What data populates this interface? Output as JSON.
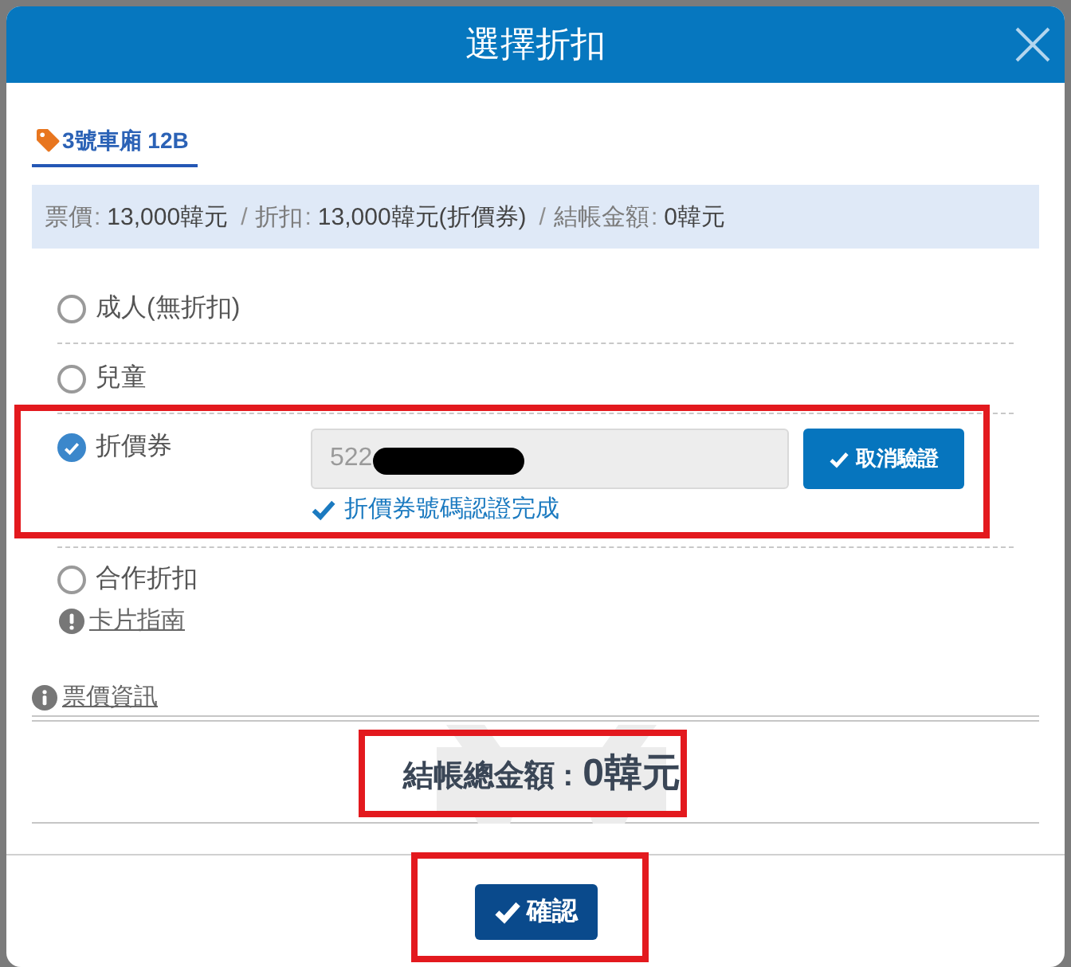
{
  "dialog": {
    "title": "選擇折扣"
  },
  "tabs": [
    {
      "label": "3號車廂 12B",
      "selected": true
    }
  ],
  "summary": [
    {
      "label": "票價",
      "colon": ":",
      "value": "13,000韓元"
    },
    {
      "divider": "/",
      "label": "折扣",
      "colon": ":",
      "value": "13,000韓元(折價券)"
    },
    {
      "divider": "/",
      "label": "結帳金額",
      "colon": ":",
      "value": "0韓元"
    }
  ],
  "options": [
    {
      "kind": "plain",
      "label": "成人(無折扣)",
      "selected": false
    },
    {
      "kind": "plain",
      "label": "兒童",
      "selected": false
    },
    {
      "kind": "voucher",
      "label": "折價券",
      "selected": true,
      "highlighted": true,
      "field": {
        "value": "522",
        "disabled": true,
        "redacted": true
      },
      "button": "取消驗證",
      "message": "折價券號碼認證完成"
    },
    {
      "kind": "partner",
      "label": "合作折扣",
      "selected": false,
      "link": "卡片指南"
    }
  ],
  "info_link": "票價資訊",
  "total": {
    "label": "結帳總金額 :",
    "value": "0韓元",
    "highlighted": true
  },
  "confirm": {
    "label": "確認",
    "highlighted": true
  }
}
